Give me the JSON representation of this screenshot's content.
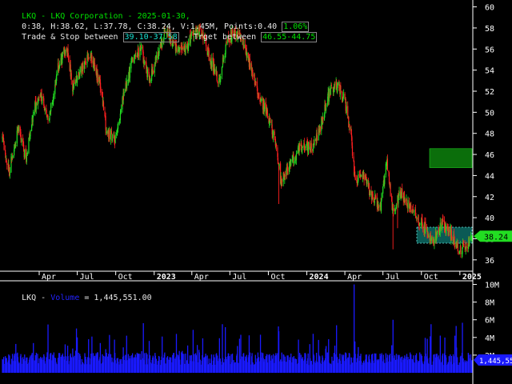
{
  "colors": {
    "background": "#000000",
    "up_candle": "#22dd22",
    "down_candle": "#ff2020",
    "volume": "#1a1aff",
    "target_zone": "#0b6e0b",
    "stop_zone": "#0b5a55",
    "current_price": "#22dd22",
    "grid": "#3a3a3a"
  },
  "header": {
    "title_line": "LKQ - LKQ Corporation - 2025-01-30,",
    "ohlc_text": "0:38, H:38.62, L:37.78, C:38.24, V:1.45M, Points:0.40",
    "change_pct": "1.06%",
    "trade_prefix": "Trade & Stop between ",
    "trade_range": "39.10-37.58",
    "target_prefix": " - Trget between ",
    "target_range": "46.55-44.75"
  },
  "volume_header": {
    "symbol": "LKQ - ",
    "label": "Volume",
    "value_text": " = 1,445,551.00"
  },
  "current_price_label": "38.24",
  "current_volume_label": "1,445,55",
  "chart_data": [
    {
      "type": "candlestick",
      "title": "LKQ - LKQ Corporation - 2025-01-30",
      "y_ticks": [
        "60",
        "58",
        "56",
        "54",
        "52",
        "50",
        "48",
        "46",
        "44",
        "42",
        "40",
        "38",
        "36"
      ],
      "ylim": [
        35,
        60.5
      ],
      "x_ticks": [
        "Apr",
        "Jul",
        "Oct",
        "2023",
        "Apr",
        "Jul",
        "Oct",
        "2024",
        "Apr",
        "Jul",
        "Oct",
        "2025"
      ],
      "x_ticks_bold": [
        "2023",
        "2024",
        "2025"
      ],
      "x_range": [
        "2022-01-03",
        "2025-01-30"
      ],
      "last_close": 38.24,
      "trade_stop_zone": [
        37.58,
        39.1
      ],
      "target_zone": [
        44.75,
        46.55
      ],
      "zone_start": "2024-09-20",
      "price_path": [
        [
          "2022-01-03",
          47.5
        ],
        [
          "2022-01-20",
          44.5
        ],
        [
          "2022-02-10",
          48.5
        ],
        [
          "2022-03-01",
          45.5
        ],
        [
          "2022-03-20",
          50.5
        ],
        [
          "2022-04-05",
          51.5
        ],
        [
          "2022-04-25",
          49.5
        ],
        [
          "2022-05-15",
          54.0
        ],
        [
          "2022-06-05",
          56.3
        ],
        [
          "2022-06-20",
          52.5
        ],
        [
          "2022-07-10",
          54.0
        ],
        [
          "2022-08-01",
          55.5
        ],
        [
          "2022-08-25",
          52.5
        ],
        [
          "2022-09-10",
          48.0
        ],
        [
          "2022-09-30",
          47.5
        ],
        [
          "2022-10-20",
          51.5
        ],
        [
          "2022-11-10",
          55.0
        ],
        [
          "2022-11-30",
          56.0
        ],
        [
          "2022-12-20",
          53.0
        ],
        [
          "2023-01-10",
          55.5
        ],
        [
          "2023-01-30",
          58.0
        ],
        [
          "2023-02-20",
          56.0
        ],
        [
          "2023-03-15",
          55.8
        ],
        [
          "2023-04-05",
          57.5
        ],
        [
          "2023-04-25",
          57.8
        ],
        [
          "2023-05-15",
          55.0
        ],
        [
          "2023-06-05",
          53.0
        ],
        [
          "2023-06-25",
          57.0
        ],
        [
          "2023-07-15",
          57.5
        ],
        [
          "2023-08-05",
          56.5
        ],
        [
          "2023-08-25",
          53.5
        ],
        [
          "2023-09-15",
          51.0
        ],
        [
          "2023-10-01",
          49.5
        ],
        [
          "2023-10-20",
          47.0
        ],
        [
          "2023-10-30",
          43.5
        ],
        [
          "2023-11-15",
          44.5
        ],
        [
          "2023-12-05",
          46.0
        ],
        [
          "2023-12-25",
          47.0
        ],
        [
          "2024-01-15",
          46.5
        ],
        [
          "2024-02-05",
          49.0
        ],
        [
          "2024-02-25",
          52.0
        ],
        [
          "2024-03-15",
          52.5
        ],
        [
          "2024-04-01",
          51.0
        ],
        [
          "2024-04-15",
          48.0
        ],
        [
          "2024-04-25",
          43.5
        ],
        [
          "2024-05-15",
          44.0
        ],
        [
          "2024-06-05",
          42.0
        ],
        [
          "2024-06-25",
          41.0
        ],
        [
          "2024-07-10",
          45.5
        ],
        [
          "2024-07-25",
          40.5
        ],
        [
          "2024-08-15",
          42.5
        ],
        [
          "2024-09-01",
          41.0
        ],
        [
          "2024-09-20",
          40.0
        ],
        [
          "2024-10-10",
          39.0
        ],
        [
          "2024-10-30",
          37.8
        ],
        [
          "2024-11-20",
          39.5
        ],
        [
          "2024-12-10",
          38.5
        ],
        [
          "2024-12-30",
          37.0
        ],
        [
          "2025-01-15",
          37.3
        ],
        [
          "2025-01-30",
          38.24
        ]
      ]
    },
    {
      "type": "bar",
      "title": "Volume",
      "y_ticks": [
        "10M",
        "8M",
        "6M",
        "4M",
        "2M"
      ],
      "ylim": [
        0,
        10500000
      ],
      "last_value": 1445551,
      "typical_volume": 1600000,
      "spikes": [
        [
          "2022-07-28",
          3800000
        ],
        [
          "2022-10-27",
          4200000
        ],
        [
          "2023-02-23",
          4400000
        ],
        [
          "2023-04-27",
          3900000
        ],
        [
          "2023-07-27",
          4300000
        ],
        [
          "2023-10-26",
          4700000
        ],
        [
          "2024-02-22",
          3800000
        ],
        [
          "2024-04-23",
          10000000
        ],
        [
          "2024-07-25",
          6000000
        ],
        [
          "2024-10-24",
          5500000
        ],
        [
          "2024-12-20",
          4200000
        ]
      ]
    }
  ]
}
